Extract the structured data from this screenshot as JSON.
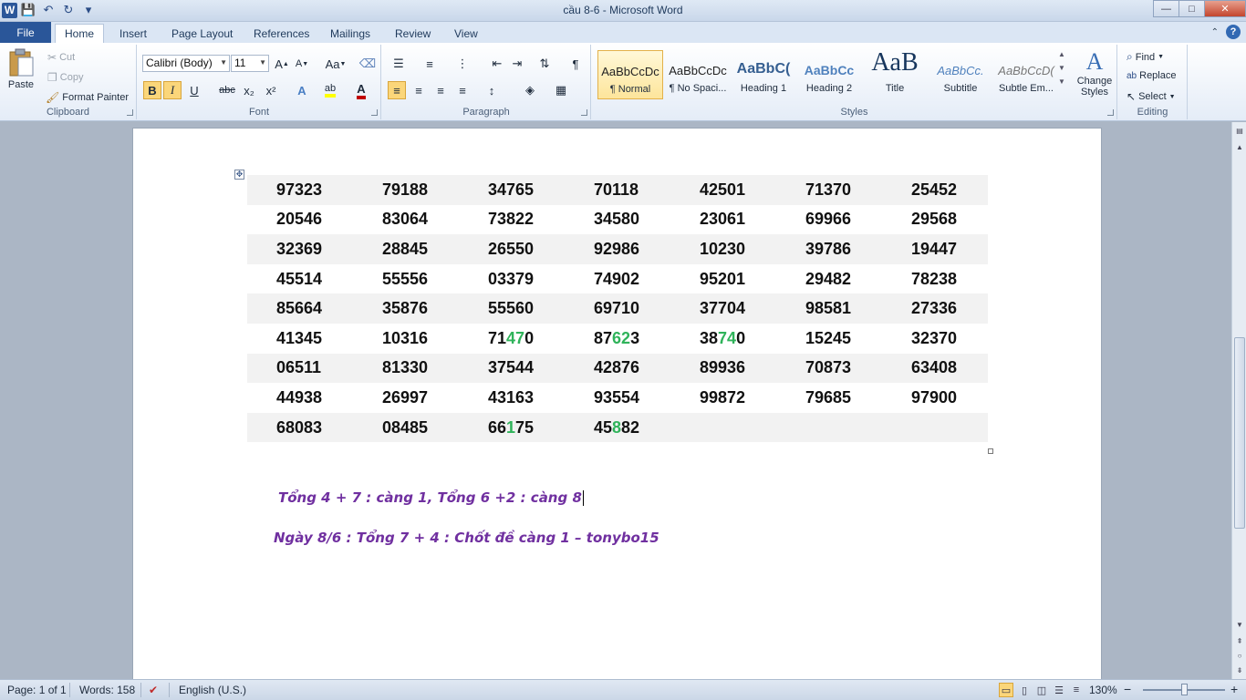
{
  "window": {
    "title": "cầu 8-6  -  Microsoft Word",
    "controls": {
      "minimize": "—",
      "maximize": "□",
      "close": "✕"
    }
  },
  "qat": {
    "logo": "W",
    "save_icon": "💾",
    "undo_icon": "↶",
    "redo_icon": "↻",
    "customize_icon": "▾"
  },
  "tabs": [
    {
      "label": "File"
    },
    {
      "label": "Home"
    },
    {
      "label": "Insert"
    },
    {
      "label": "Page Layout"
    },
    {
      "label": "References"
    },
    {
      "label": "Mailings"
    },
    {
      "label": "Review"
    },
    {
      "label": "View"
    }
  ],
  "clipboard": {
    "paste": "Paste",
    "cut": "Cut",
    "copy": "Copy",
    "format_painter": "Format Painter",
    "label": "Clipboard"
  },
  "font": {
    "name": "Calibri (Body)",
    "size": "11",
    "label": "Font",
    "bold": "B",
    "italic": "I",
    "underline": "U",
    "strike": "abc",
    "sub": "x₂",
    "sup": "x²",
    "grow": "A",
    "shrink": "A",
    "case": "Aa",
    "font_color": "A",
    "highlight": "ab"
  },
  "paragraph": {
    "label": "Paragraph",
    "pilcrow": "¶"
  },
  "styles": {
    "label": "Styles",
    "items": [
      {
        "preview": "AaBbCcDc",
        "name": "¶ Normal"
      },
      {
        "preview": "AaBbCcDc",
        "name": "¶ No Spaci..."
      },
      {
        "preview": "AaBbC(",
        "name": "Heading 1"
      },
      {
        "preview": "AaBbCc",
        "name": "Heading 2"
      },
      {
        "preview": "AaB",
        "name": "Title"
      },
      {
        "preview": "AaBbCc.",
        "name": "Subtitle"
      },
      {
        "preview": "AaBbCcD(",
        "name": "Subtle Em..."
      }
    ],
    "change_styles": "Change Styles"
  },
  "editing": {
    "label": "Editing",
    "find": "Find",
    "replace": "Replace",
    "select": "Select"
  },
  "document": {
    "table_move_icon": "✥",
    "rows": [
      [
        "97323",
        "79188",
        "34765",
        "70118",
        "42501",
        "71370",
        "25452"
      ],
      [
        "20546",
        "83064",
        "73822",
        "34580",
        "23061",
        "69966",
        "29568"
      ],
      [
        "32369",
        "28845",
        "26550",
        "92986",
        "10230",
        "39786",
        "19447"
      ],
      [
        "45514",
        "55556",
        "03379",
        "74902",
        "95201",
        "29482",
        "78238"
      ],
      [
        "85664",
        "35876",
        "55560",
        "69710",
        "37704",
        "98581",
        "27336"
      ],
      [
        "41345",
        "10316",
        "71470",
        "87623",
        "38740",
        "15245",
        "32370"
      ],
      [
        "06511",
        "81330",
        "37544",
        "42876",
        "89936",
        "70873",
        "63408"
      ],
      [
        "44938",
        "26997",
        "43163",
        "93554",
        "99872",
        "79685",
        "97900"
      ],
      [
        "68083",
        "08485",
        "66175",
        "45882",
        "",
        "",
        ""
      ]
    ],
    "highlights": [
      {
        "row": 5,
        "col": 2,
        "start": 2,
        "end": 4
      },
      {
        "row": 5,
        "col": 3,
        "start": 2,
        "end": 4
      },
      {
        "row": 5,
        "col": 4,
        "start": 2,
        "end": 4
      },
      {
        "row": 8,
        "col": 2,
        "start": 2,
        "end": 3
      },
      {
        "row": 8,
        "col": 3,
        "start": 2,
        "end": 3
      }
    ],
    "highlight_color": "#2fb35a",
    "text_color": "#7030a0",
    "line1": "Tổng 4 + 7 : càng 1, Tổng 6 +2 : càng 8",
    "line2": "Ngày 8/6 : Tổng 7 + 4 : Chốt đề càng 1 – tonybo15"
  },
  "status": {
    "page": "Page: 1 of 1",
    "words": "Words: 158",
    "language": "English (U.S.)",
    "zoom": "130%",
    "zoom_minus": "−",
    "zoom_plus": "+"
  }
}
